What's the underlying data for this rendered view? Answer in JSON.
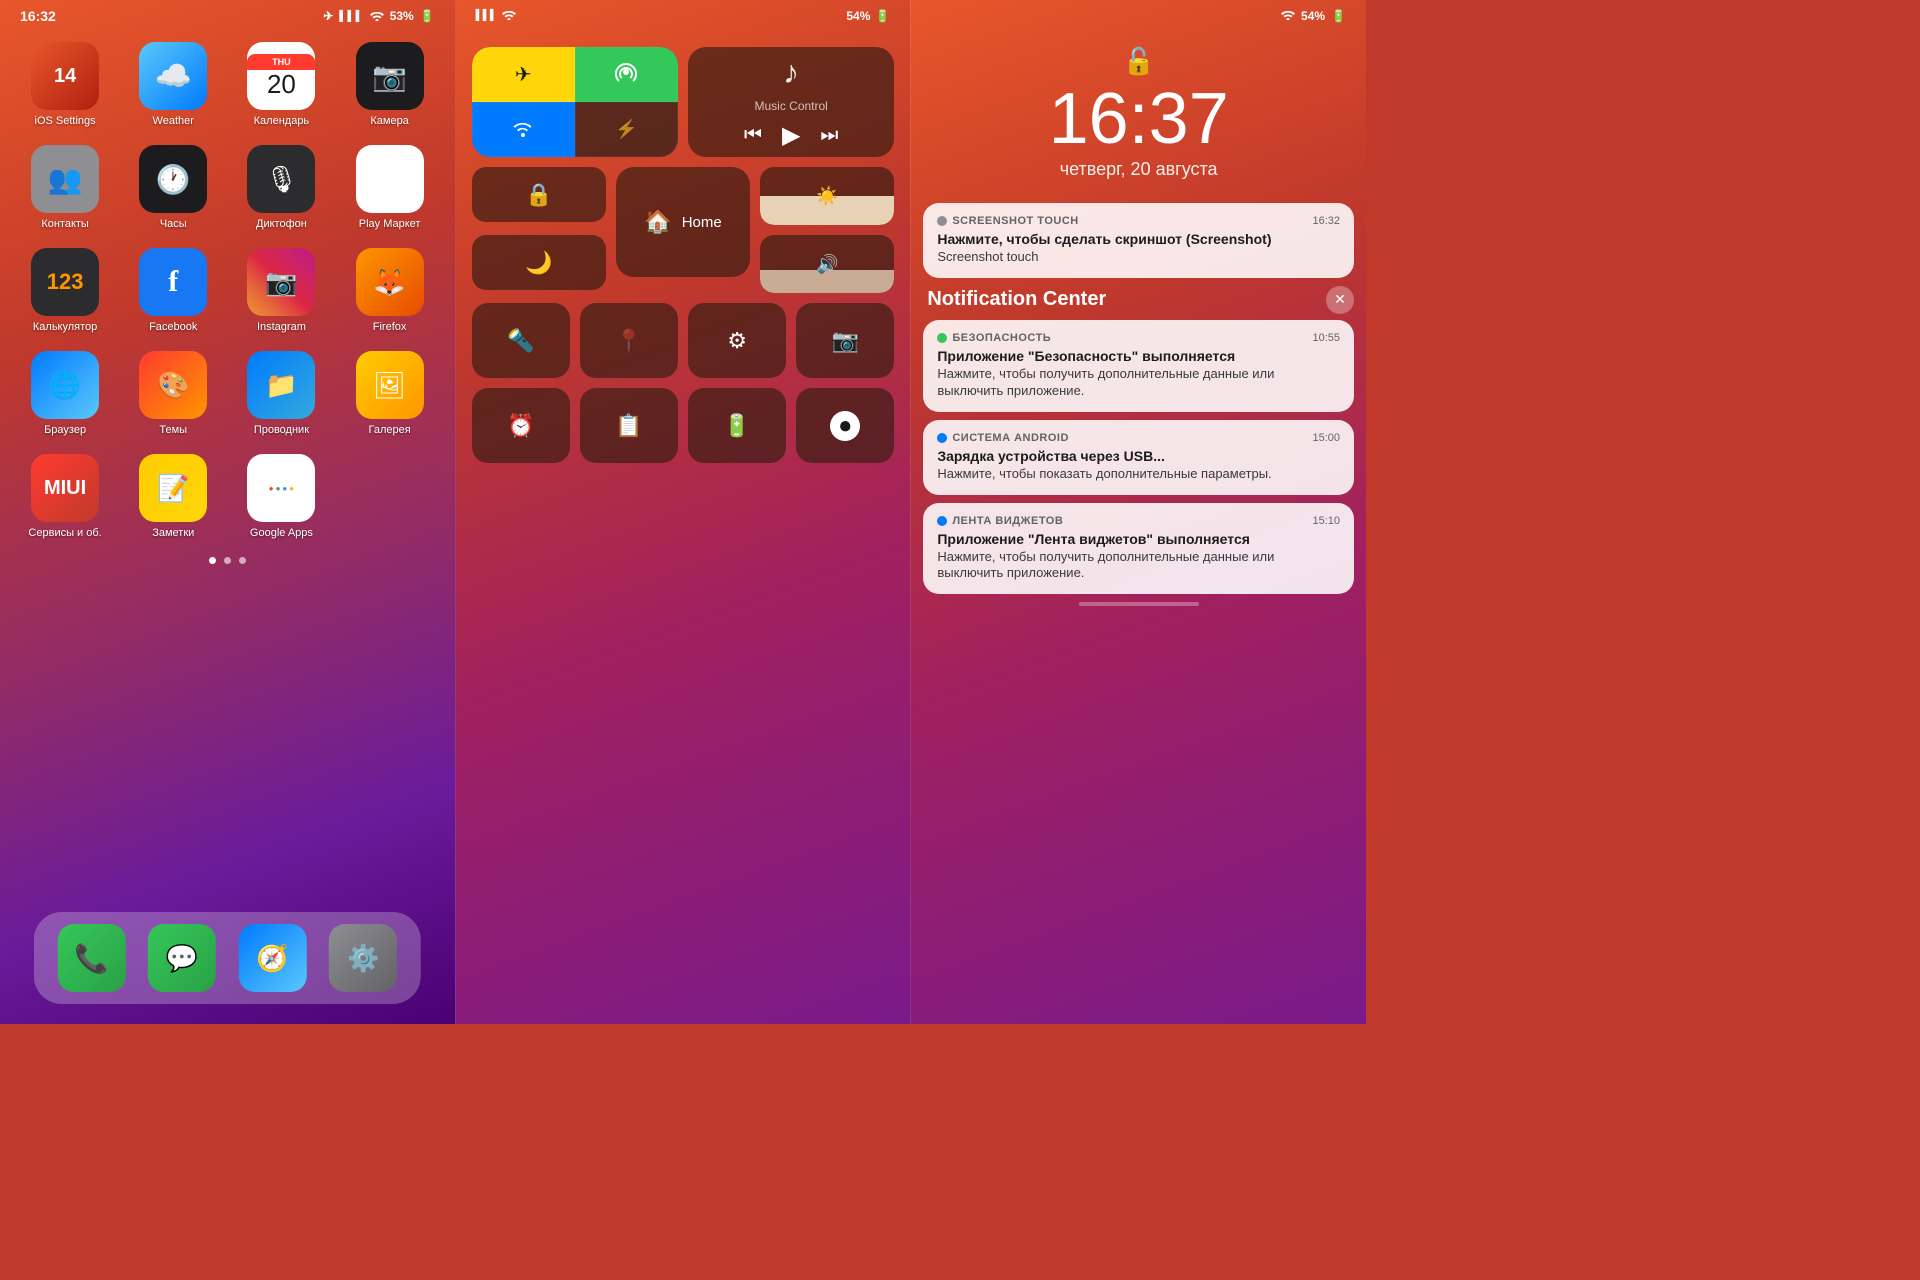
{
  "panel1": {
    "statusBar": {
      "time": "16:32",
      "signal": "●●●",
      "wifi": "WiFi",
      "battery": "53%"
    },
    "apps": [
      {
        "id": "ios-settings",
        "label": "iOS Settings",
        "icon": "⚙️",
        "bgClass": "bg-red"
      },
      {
        "id": "weather",
        "label": "Weather",
        "icon": "🌤",
        "bgClass": "weather-icon"
      },
      {
        "id": "calendar",
        "label": "Календарь",
        "icon": "📅",
        "bgClass": "calendar-icon",
        "dayName": "THU",
        "dayNum": "20"
      },
      {
        "id": "camera",
        "label": "Камера",
        "icon": "📷",
        "bgClass": "camera-bg"
      },
      {
        "id": "contacts",
        "label": "Контакты",
        "icon": "👥",
        "bgClass": "bg-gray"
      },
      {
        "id": "clock",
        "label": "Часы",
        "icon": "🕐",
        "bgClass": "clock-bg"
      },
      {
        "id": "dictaphone",
        "label": "Диктофон",
        "icon": "🎤",
        "bgClass": "bg-dark"
      },
      {
        "id": "playmarket",
        "label": "Play Маркет",
        "icon": "▶",
        "bgClass": "bg-blue"
      },
      {
        "id": "calculator",
        "label": "Калькулятор",
        "icon": "🔢",
        "bgClass": "bg-dark"
      },
      {
        "id": "facebook",
        "label": "Facebook",
        "icon": "f",
        "bgClass": "bg-fb"
      },
      {
        "id": "instagram",
        "label": "Instagram",
        "icon": "📷",
        "bgClass": "bg-insta"
      },
      {
        "id": "firefox",
        "label": "Firefox",
        "icon": "🦊",
        "bgClass": "bg-firefox"
      },
      {
        "id": "browser",
        "label": "Браузер",
        "icon": "🌐",
        "bgClass": "bg-browser"
      },
      {
        "id": "themes",
        "label": "Темы",
        "icon": "🎨",
        "bgClass": "bg-theme"
      },
      {
        "id": "explorer",
        "label": "Проводник",
        "icon": "📁",
        "bgClass": "bg-files"
      },
      {
        "id": "gallery",
        "label": "Галерея",
        "icon": "🖼",
        "bgClass": "bg-gallery"
      },
      {
        "id": "services",
        "label": "Сервисы и об.",
        "icon": "⚙",
        "bgClass": "bg-red"
      },
      {
        "id": "notes",
        "label": "Заметки",
        "icon": "📝",
        "bgClass": "bg-notes"
      },
      {
        "id": "googleapps",
        "label": "Google Apps",
        "icon": "G",
        "bgClass": "bg-googleapps"
      }
    ],
    "dock": [
      {
        "id": "phone",
        "label": "Phone",
        "icon": "📞",
        "bgClass": "bg-phone"
      },
      {
        "id": "messages",
        "label": "Messages",
        "icon": "💬",
        "bgClass": "bg-messages"
      },
      {
        "id": "safari",
        "label": "Safari",
        "icon": "🧭",
        "bgClass": "bg-safari"
      },
      {
        "id": "settings",
        "label": "Settings",
        "icon": "⚙️",
        "bgClass": "bg-settings"
      }
    ],
    "dots": [
      0,
      1,
      2
    ],
    "activeDot": 0
  },
  "panel2": {
    "statusBar": {
      "signal": "●●●",
      "wifi": "WiFi",
      "battery": "54%"
    },
    "connectivity": {
      "airplane": {
        "active": true,
        "icon": "✈"
      },
      "hotspot": {
        "active": true,
        "icon": "📶"
      },
      "wifi": {
        "active": true,
        "icon": "WiFi"
      },
      "bluetooth": {
        "active": false,
        "icon": "Bluetooth"
      }
    },
    "musicControl": {
      "label": "Music Control",
      "noteIcon": "♪",
      "prevIcon": "⏮",
      "playIcon": "▶",
      "nextIcon": "⏭"
    },
    "orientation": {
      "icon": "🔒"
    },
    "doNotDisturb": {
      "icon": "🌙"
    },
    "brightness": {
      "value": 50
    },
    "volume": {
      "value": 40
    },
    "home": {
      "label": "Home"
    },
    "tools": [
      {
        "id": "flashlight",
        "icon": "🔦"
      },
      {
        "id": "location-off",
        "icon": "📍"
      },
      {
        "id": "settings2",
        "icon": "⚙"
      },
      {
        "id": "camera2",
        "icon": "📷"
      }
    ],
    "tools2": [
      {
        "id": "alarm",
        "icon": "⏰"
      },
      {
        "id": "scan",
        "icon": "📋"
      },
      {
        "id": "battery2",
        "icon": "🔋"
      },
      {
        "id": "record",
        "icon": "⏺"
      }
    ]
  },
  "panel3": {
    "statusBar": {
      "wifi": "WiFi",
      "battery": "54%"
    },
    "lockIcon": "🔓",
    "time": "16:37",
    "date": "четверг, 20 августа",
    "screenshotNotif": {
      "appName": "SCREENSHOT TOUCH",
      "appDotColor": "#8e8e93",
      "time": "16:32",
      "title": "Нажмите, чтобы сделать скриншот (Screenshot)",
      "body": "Screenshot touch"
    },
    "notificationCenter": "Notification Center",
    "notifications": [
      {
        "id": "bezopasnost",
        "appName": "БЕЗОПАСНОСТЬ",
        "appDotColor": "#34c759",
        "time": "10:55",
        "title": "Приложение \"Безопасность\" выполняется",
        "body": "Нажмите, чтобы получить дополнительные данные или выключить приложение."
      },
      {
        "id": "android",
        "appName": "СИСТЕМА ANDROID",
        "appDotColor": "#007aff",
        "time": "15:00",
        "title": "Зарядка устройства через USB...",
        "body": "Нажмите, чтобы показать дополнительные параметры."
      },
      {
        "id": "widgets",
        "appName": "ЛЕНТА ВИДЖЕТОВ",
        "appDotColor": "#007aff",
        "time": "15:10",
        "title": "Приложение \"Лента виджетов\" выполняется",
        "body": "Нажмите, чтобы получить дополнительные данные или выключить приложение."
      }
    ]
  }
}
